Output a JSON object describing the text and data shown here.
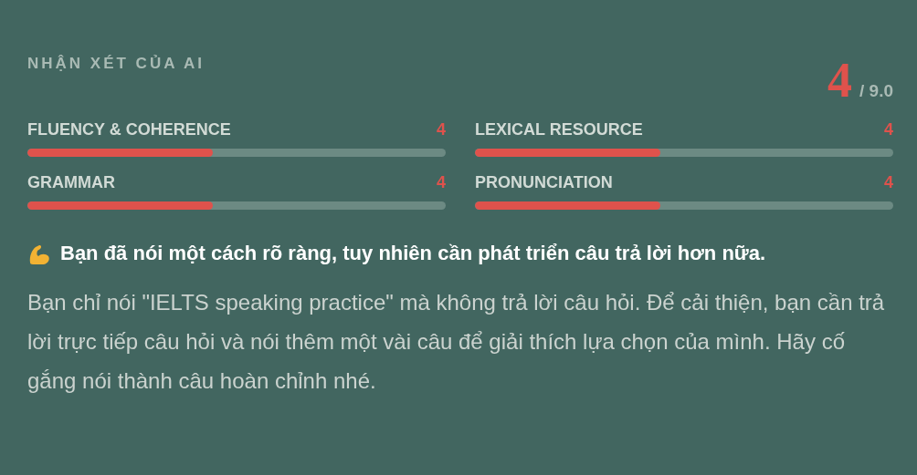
{
  "heading": "NHẬN XÉT CỦA AI",
  "score": {
    "value": "4",
    "max": "/ 9.0"
  },
  "criteria": [
    {
      "label": "FLUENCY & COHERENCE",
      "score": "4",
      "level": 0.444
    },
    {
      "label": "LEXICAL RESOURCE",
      "score": "4",
      "level": 0.444
    },
    {
      "label": "GRAMMAR",
      "score": "4",
      "level": 0.444
    },
    {
      "label": "PRONUNCIATION",
      "score": "4",
      "level": 0.444
    }
  ],
  "summary": "Bạn đã nói một cách rõ ràng, tuy nhiên cần phát triển câu trả lời hơn nữa.",
  "detail": "Bạn chỉ nói \"IELTS speaking practice\" mà không trả lời câu hỏi. Để cải thiện, bạn cần trả lời trực tiếp câu hỏi và nói thêm một vài câu để giải thích lựa chọn của mình. Hãy cố gắng nói thành câu hoàn chỉnh nhé."
}
